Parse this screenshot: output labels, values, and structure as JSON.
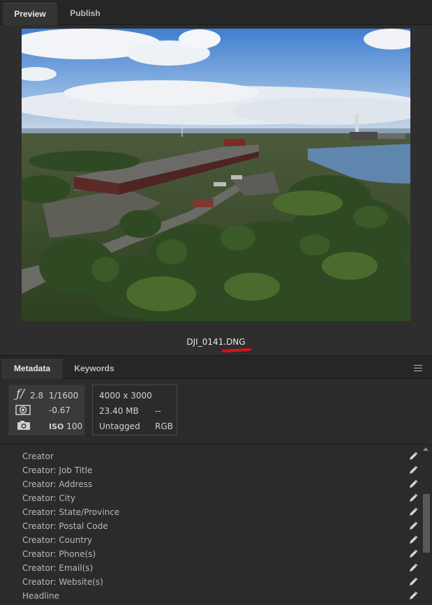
{
  "top_tabs": [
    {
      "label": "Preview",
      "active": true
    },
    {
      "label": "Publish",
      "active": false
    }
  ],
  "preview": {
    "image_description_icon": "aerial-photo-industrial-site",
    "filename_prefix": "DJI_0141",
    "filename_ext": ".DNG"
  },
  "meta_tabs": [
    {
      "label": "Metadata",
      "active": true
    },
    {
      "label": "Keywords",
      "active": false
    }
  ],
  "camera_info": {
    "aperture_icon": "f-stop-icon",
    "aperture": "2.8",
    "shutter": "1/1600",
    "exposure_comp": "-0.67",
    "iso_label": "ISO",
    "iso_value": "100"
  },
  "file_info": {
    "dimensions": "4000 x 3000",
    "size": "23.40 MB",
    "size_extra": "--",
    "color_label": "Untagged",
    "color_mode": "RGB"
  },
  "fields": [
    "Creator",
    "Creator: Job Title",
    "Creator: Address",
    "Creator: City",
    "Creator: State/Province",
    "Creator: Postal Code",
    "Creator: Country",
    "Creator: Phone(s)",
    "Creator: Email(s)",
    "Creator: Website(s)",
    "Headline"
  ],
  "colors": {
    "accent_red": "#d4151b",
    "panel_bg": "#2b2b2b"
  }
}
